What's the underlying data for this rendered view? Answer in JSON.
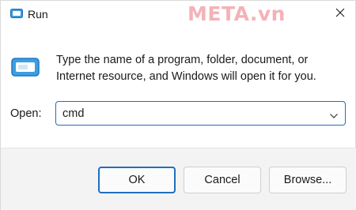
{
  "window": {
    "title": "Run",
    "watermark": "META.vn",
    "close_icon": "close-icon",
    "app_icon": "run-icon"
  },
  "content": {
    "description": "Type the name of a program, folder, document, or Internet resource, and Windows will open it for you.",
    "open_label": "Open:",
    "open_value": "cmd",
    "dropdown_icon": "chevron-down-icon"
  },
  "buttons": {
    "ok": "OK",
    "cancel": "Cancel",
    "browse": "Browse..."
  },
  "colors": {
    "accent": "#1f6fbf",
    "footer_bg": "#f3f3f3",
    "watermark": "#f4b2b8"
  }
}
